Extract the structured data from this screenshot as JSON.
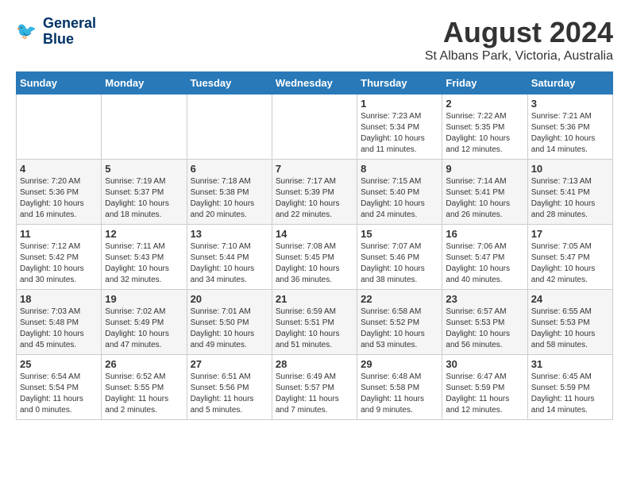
{
  "header": {
    "logo_line1": "General",
    "logo_line2": "Blue",
    "month_year": "August 2024",
    "location": "St Albans Park, Victoria, Australia"
  },
  "weekdays": [
    "Sunday",
    "Monday",
    "Tuesday",
    "Wednesday",
    "Thursday",
    "Friday",
    "Saturday"
  ],
  "weeks": [
    [
      {
        "day": "",
        "info": ""
      },
      {
        "day": "",
        "info": ""
      },
      {
        "day": "",
        "info": ""
      },
      {
        "day": "",
        "info": ""
      },
      {
        "day": "1",
        "info": "Sunrise: 7:23 AM\nSunset: 5:34 PM\nDaylight: 10 hours\nand 11 minutes."
      },
      {
        "day": "2",
        "info": "Sunrise: 7:22 AM\nSunset: 5:35 PM\nDaylight: 10 hours\nand 12 minutes."
      },
      {
        "day": "3",
        "info": "Sunrise: 7:21 AM\nSunset: 5:36 PM\nDaylight: 10 hours\nand 14 minutes."
      }
    ],
    [
      {
        "day": "4",
        "info": "Sunrise: 7:20 AM\nSunset: 5:36 PM\nDaylight: 10 hours\nand 16 minutes."
      },
      {
        "day": "5",
        "info": "Sunrise: 7:19 AM\nSunset: 5:37 PM\nDaylight: 10 hours\nand 18 minutes."
      },
      {
        "day": "6",
        "info": "Sunrise: 7:18 AM\nSunset: 5:38 PM\nDaylight: 10 hours\nand 20 minutes."
      },
      {
        "day": "7",
        "info": "Sunrise: 7:17 AM\nSunset: 5:39 PM\nDaylight: 10 hours\nand 22 minutes."
      },
      {
        "day": "8",
        "info": "Sunrise: 7:15 AM\nSunset: 5:40 PM\nDaylight: 10 hours\nand 24 minutes."
      },
      {
        "day": "9",
        "info": "Sunrise: 7:14 AM\nSunset: 5:41 PM\nDaylight: 10 hours\nand 26 minutes."
      },
      {
        "day": "10",
        "info": "Sunrise: 7:13 AM\nSunset: 5:41 PM\nDaylight: 10 hours\nand 28 minutes."
      }
    ],
    [
      {
        "day": "11",
        "info": "Sunrise: 7:12 AM\nSunset: 5:42 PM\nDaylight: 10 hours\nand 30 minutes."
      },
      {
        "day": "12",
        "info": "Sunrise: 7:11 AM\nSunset: 5:43 PM\nDaylight: 10 hours\nand 32 minutes."
      },
      {
        "day": "13",
        "info": "Sunrise: 7:10 AM\nSunset: 5:44 PM\nDaylight: 10 hours\nand 34 minutes."
      },
      {
        "day": "14",
        "info": "Sunrise: 7:08 AM\nSunset: 5:45 PM\nDaylight: 10 hours\nand 36 minutes."
      },
      {
        "day": "15",
        "info": "Sunrise: 7:07 AM\nSunset: 5:46 PM\nDaylight: 10 hours\nand 38 minutes."
      },
      {
        "day": "16",
        "info": "Sunrise: 7:06 AM\nSunset: 5:47 PM\nDaylight: 10 hours\nand 40 minutes."
      },
      {
        "day": "17",
        "info": "Sunrise: 7:05 AM\nSunset: 5:47 PM\nDaylight: 10 hours\nand 42 minutes."
      }
    ],
    [
      {
        "day": "18",
        "info": "Sunrise: 7:03 AM\nSunset: 5:48 PM\nDaylight: 10 hours\nand 45 minutes."
      },
      {
        "day": "19",
        "info": "Sunrise: 7:02 AM\nSunset: 5:49 PM\nDaylight: 10 hours\nand 47 minutes."
      },
      {
        "day": "20",
        "info": "Sunrise: 7:01 AM\nSunset: 5:50 PM\nDaylight: 10 hours\nand 49 minutes."
      },
      {
        "day": "21",
        "info": "Sunrise: 6:59 AM\nSunset: 5:51 PM\nDaylight: 10 hours\nand 51 minutes."
      },
      {
        "day": "22",
        "info": "Sunrise: 6:58 AM\nSunset: 5:52 PM\nDaylight: 10 hours\nand 53 minutes."
      },
      {
        "day": "23",
        "info": "Sunrise: 6:57 AM\nSunset: 5:53 PM\nDaylight: 10 hours\nand 56 minutes."
      },
      {
        "day": "24",
        "info": "Sunrise: 6:55 AM\nSunset: 5:53 PM\nDaylight: 10 hours\nand 58 minutes."
      }
    ],
    [
      {
        "day": "25",
        "info": "Sunrise: 6:54 AM\nSunset: 5:54 PM\nDaylight: 11 hours\nand 0 minutes."
      },
      {
        "day": "26",
        "info": "Sunrise: 6:52 AM\nSunset: 5:55 PM\nDaylight: 11 hours\nand 2 minutes."
      },
      {
        "day": "27",
        "info": "Sunrise: 6:51 AM\nSunset: 5:56 PM\nDaylight: 11 hours\nand 5 minutes."
      },
      {
        "day": "28",
        "info": "Sunrise: 6:49 AM\nSunset: 5:57 PM\nDaylight: 11 hours\nand 7 minutes."
      },
      {
        "day": "29",
        "info": "Sunrise: 6:48 AM\nSunset: 5:58 PM\nDaylight: 11 hours\nand 9 minutes."
      },
      {
        "day": "30",
        "info": "Sunrise: 6:47 AM\nSunset: 5:59 PM\nDaylight: 11 hours\nand 12 minutes."
      },
      {
        "day": "31",
        "info": "Sunrise: 6:45 AM\nSunset: 5:59 PM\nDaylight: 11 hours\nand 14 minutes."
      }
    ]
  ]
}
